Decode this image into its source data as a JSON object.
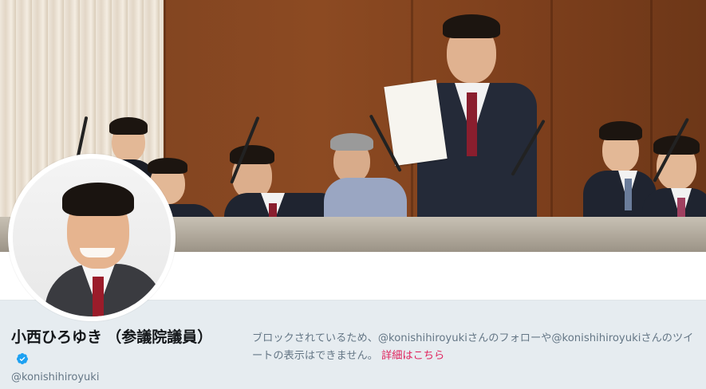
{
  "profile": {
    "display_name": "小西ひろゆき （参議院議員）",
    "handle": "@konishihiroyuki",
    "verified": true
  },
  "blocked_notice": {
    "message": "ブロックされているため、@konishihiroyukiさんのフォローや@konishihiroyukiさんのツイートの表示はできません。",
    "link_label": "詳細はこちら"
  },
  "colors": {
    "accent_link": "#e0245e",
    "verified_blue": "#1da1f2",
    "profile_bar_bg": "#e6ecf0",
    "secondary_text": "#657786"
  },
  "icons": {
    "verified": "verified-badge-icon"
  }
}
